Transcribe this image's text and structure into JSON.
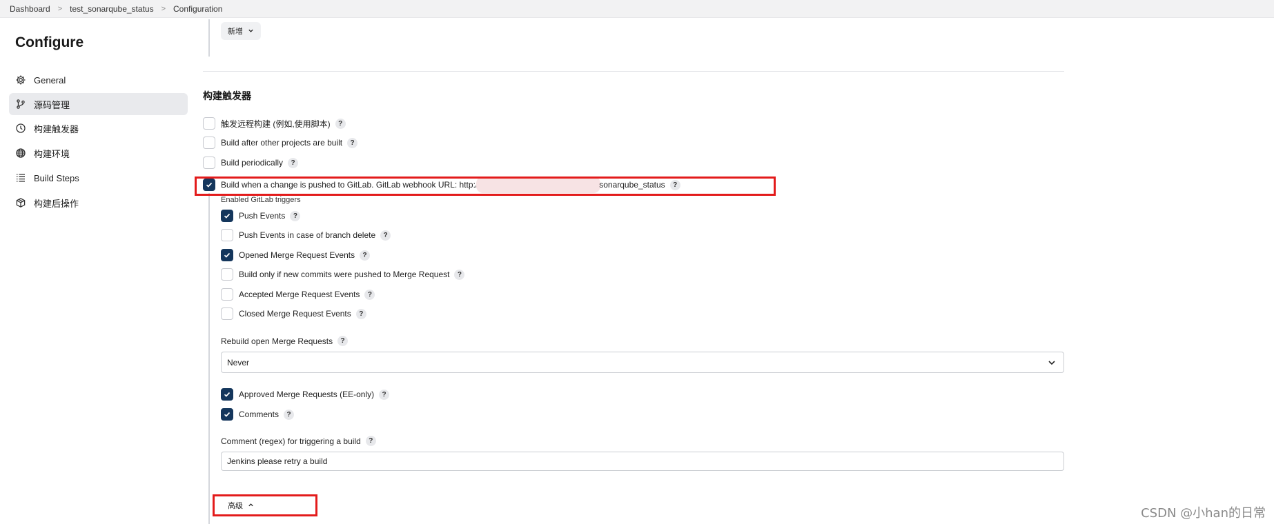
{
  "breadcrumb": {
    "items": [
      "Dashboard",
      "test_sonarqube_status",
      "Configuration"
    ],
    "separator": ">"
  },
  "sidebar": {
    "title": "Configure",
    "items": [
      {
        "label": "General",
        "icon": "gear-icon",
        "active": false
      },
      {
        "label": "源码管理",
        "icon": "branch-icon",
        "active": true
      },
      {
        "label": "构建触发器",
        "icon": "clock-icon",
        "active": false
      },
      {
        "label": "构建环境",
        "icon": "globe-icon",
        "active": false
      },
      {
        "label": "Build Steps",
        "icon": "list-icon",
        "active": false
      },
      {
        "label": "构建后操作",
        "icon": "package-icon",
        "active": false
      }
    ]
  },
  "main": {
    "add_button_label": "新增",
    "section_title": "构建触发器",
    "triggers": [
      {
        "label": "触发远程构建 (例如,使用脚本)",
        "checked": false
      },
      {
        "label": "Build after other projects are built",
        "checked": false
      },
      {
        "label": "Build periodically",
        "checked": false
      },
      {
        "label_prefix": "Build when a change is pushed to GitLab. GitLab webhook URL: http:/",
        "label_suffix": "sonarqube_status",
        "checked": true
      }
    ],
    "gitlab_triggers_label": "Enabled GitLab triggers",
    "gitlab_triggers": [
      {
        "label": "Push Events",
        "checked": true
      },
      {
        "label": "Push Events in case of branch delete",
        "checked": false
      },
      {
        "label": "Opened Merge Request Events",
        "checked": true
      },
      {
        "label": "Build only if new commits were pushed to Merge Request",
        "checked": false
      },
      {
        "label": "Accepted Merge Request Events",
        "checked": false
      },
      {
        "label": "Closed Merge Request Events",
        "checked": false
      }
    ],
    "rebuild_label": "Rebuild open Merge Requests",
    "rebuild_value": "Never",
    "extra_triggers": [
      {
        "label": "Approved Merge Requests (EE-only)",
        "checked": true
      },
      {
        "label": "Comments",
        "checked": true
      }
    ],
    "comment_regex_label": "Comment (regex) for triggering a build",
    "comment_regex_value": "Jenkins please retry a build",
    "advanced_button_label": "高级",
    "help_glyph": "?"
  },
  "watermark": "CSDN @小han的日常",
  "colors": {
    "checkbox_checked": "#14365c",
    "highlight_red": "#e31b1b",
    "active_sidebar_bg": "#e9eaed"
  }
}
